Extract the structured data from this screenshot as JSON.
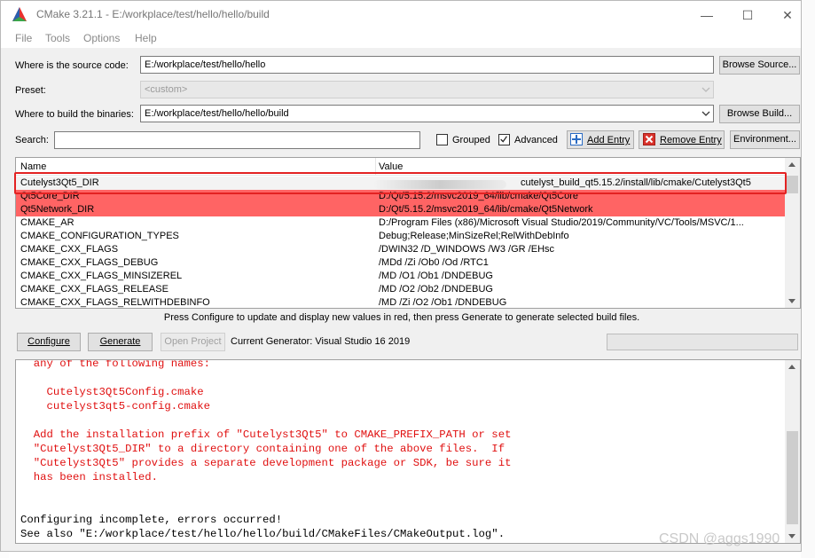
{
  "window": {
    "title": "CMake 3.21.1 - E:/workplace/test/hello/hello/build",
    "minimize": "—",
    "maximize": "☐",
    "close": "✕"
  },
  "menu": [
    "File",
    "Tools",
    "Options",
    "Help"
  ],
  "source": {
    "label": "Where is the source code:",
    "value": "E:/workplace/test/hello/hello",
    "button": "Browse Source..."
  },
  "preset": {
    "label": "Preset:",
    "value": "<custom>"
  },
  "build": {
    "label": "Where to build the binaries:",
    "value": "E:/workplace/test/hello/hello/build",
    "button": "Browse Build..."
  },
  "search": {
    "label": "Search:",
    "value": ""
  },
  "options": {
    "grouped_label": "Grouped",
    "grouped_checked": false,
    "advanced_label": "Advanced",
    "advanced_checked": true,
    "add_entry": "Add Entry",
    "remove_entry": "Remove Entry",
    "environment": "Environment..."
  },
  "table": {
    "headers": [
      "Name",
      "Value"
    ],
    "rows": [
      {
        "name": "Cutelyst3Qt5_DIR",
        "value": "cutelyst_build_qt5.15.2/install/lib/cmake/Cutelyst3Qt5",
        "state": "selected"
      },
      {
        "name": "Qt5Core_DIR",
        "value": "D:/Qt/5.15.2/msvc2019_64/lib/cmake/Qt5Core",
        "state": "new"
      },
      {
        "name": "Qt5Network_DIR",
        "value": "D:/Qt/5.15.2/msvc2019_64/lib/cmake/Qt5Network",
        "state": "new"
      },
      {
        "name": "CMAKE_AR",
        "value": "D:/Program Files (x86)/Microsoft Visual Studio/2019/Community/VC/Tools/MSVC/1...",
        "state": "normal"
      },
      {
        "name": "CMAKE_CONFIGURATION_TYPES",
        "value": "Debug;Release;MinSizeRel;RelWithDebInfo",
        "state": "normal"
      },
      {
        "name": "CMAKE_CXX_FLAGS",
        "value": "/DWIN32 /D_WINDOWS /W3 /GR /EHsc",
        "state": "normal"
      },
      {
        "name": "CMAKE_CXX_FLAGS_DEBUG",
        "value": "/MDd /Zi /Ob0 /Od /RTC1",
        "state": "normal"
      },
      {
        "name": "CMAKE_CXX_FLAGS_MINSIZEREL",
        "value": "/MD /O1 /Ob1 /DNDEBUG",
        "state": "normal"
      },
      {
        "name": "CMAKE_CXX_FLAGS_RELEASE",
        "value": "/MD /O2 /Ob2 /DNDEBUG",
        "state": "normal"
      },
      {
        "name": "CMAKE_CXX_FLAGS_RELWITHDEBINFO",
        "value": "/MD /Zi /O2 /Ob1 /DNDEBUG",
        "state": "normal"
      }
    ]
  },
  "hint": "Press Configure to update and display new values in red, then press Generate to generate selected build files.",
  "actions": {
    "configure": "Configure",
    "generate": "Generate",
    "open_project": "Open Project",
    "generator": "Current Generator: Visual Studio 16 2019"
  },
  "output": {
    "lines": [
      {
        "text": "  any of the following names:",
        "color": "red"
      },
      {
        "text": "",
        "color": "red"
      },
      {
        "text": "    Cutelyst3Qt5Config.cmake",
        "color": "red"
      },
      {
        "text": "    cutelyst3qt5-config.cmake",
        "color": "red"
      },
      {
        "text": "",
        "color": "red"
      },
      {
        "text": "  Add the installation prefix of \"Cutelyst3Qt5\" to CMAKE_PREFIX_PATH or set",
        "color": "red"
      },
      {
        "text": "  \"Cutelyst3Qt5_DIR\" to a directory containing one of the above files.  If",
        "color": "red"
      },
      {
        "text": "  \"Cutelyst3Qt5\" provides a separate development package or SDK, be sure it",
        "color": "red"
      },
      {
        "text": "  has been installed.",
        "color": "red"
      },
      {
        "text": "",
        "color": "red"
      },
      {
        "text": "",
        "color": "red"
      },
      {
        "text": "Configuring incomplete, errors occurred!",
        "color": "black"
      },
      {
        "text": "See also \"E:/workplace/test/hello/hello/build/CMakeFiles/CMakeOutput.log\".",
        "color": "black"
      }
    ]
  },
  "watermark": "CSDN @aggs1990",
  "colors": {
    "new_entry_bg": "#ff6464",
    "output_error": "#e01010",
    "highlight_border": "#e32222"
  }
}
